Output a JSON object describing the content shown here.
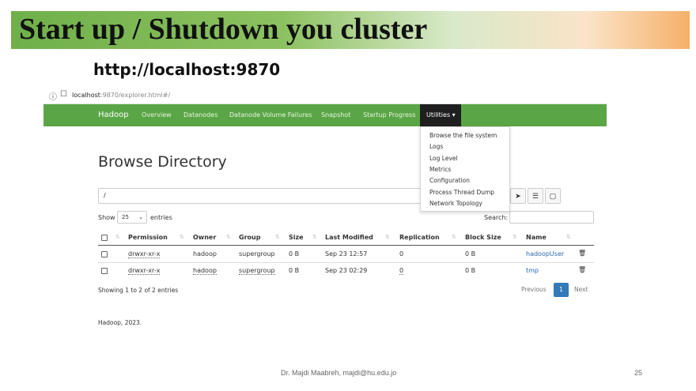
{
  "slide": {
    "title": "Start up / Shutdown you cluster",
    "url_caption": "http://localhost:9870",
    "footer": "Dr. Majdi Maabreh,  majdi@hu.edu.jo",
    "page_number": "25"
  },
  "browser": {
    "url_host": "localhost",
    "url_path": ":9870/explorer.html#/"
  },
  "nav": {
    "brand": "Hadoop",
    "items": [
      "Overview",
      "Datanodes",
      "Datanode Volume Failures",
      "Snapshot",
      "Startup Progress"
    ],
    "utilities_label": "Utilities ▾"
  },
  "dropdown": {
    "items": [
      "Browse the file system",
      "Logs",
      "Log Level",
      "Metrics",
      "Configuration",
      "Process Thread Dump",
      "Network Topology"
    ]
  },
  "main": {
    "heading": "Browse Directory",
    "path_value": "/",
    "show_label": "Show",
    "entries_value": "25",
    "entries_label": "entries",
    "search_label": "Search:"
  },
  "table": {
    "columns": [
      "Permission",
      "Owner",
      "Group",
      "Size",
      "Last Modified",
      "Replication",
      "Block Size",
      "Name"
    ],
    "rows": [
      [
        "drwxr-xr-x",
        "hadoop",
        "supergroup",
        "0 B",
        "Sep 23 12:57",
        "0",
        "0 B",
        "hadoopUser"
      ],
      [
        "drwxr-xr-x",
        "hadoop",
        "supergroup",
        "0 B",
        "Sep 23 02:29",
        "0",
        "0 B",
        "tmp"
      ]
    ],
    "info": "Showing 1 to 2 of 2 entries"
  },
  "pagination": {
    "previous": "Previous",
    "current": "1",
    "next": "Next"
  },
  "page_footer": "Hadoop, 2023.",
  "colors": {
    "navbar": "#5aa646",
    "utilities_active": "#1f1f1f",
    "link": "#2a6aad",
    "page_active": "#337ab7"
  }
}
